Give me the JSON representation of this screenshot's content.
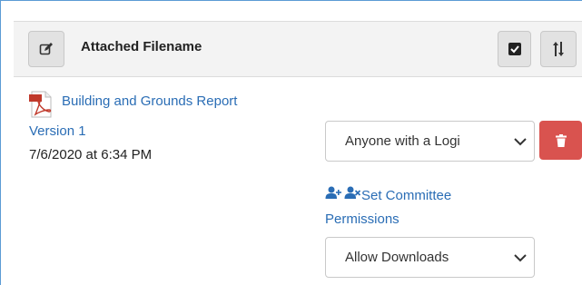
{
  "header": {
    "title": "Attached Filename"
  },
  "attachment": {
    "name": "Building and Grounds Report",
    "version": "Version 1",
    "date": "7/6/2020 at 6:34 PM"
  },
  "access_select": {
    "selected": "Anyone with a Logi"
  },
  "permissions": {
    "link_label": "Set Committee Permissions"
  },
  "download_select": {
    "selected": "Allow Downloads"
  },
  "colors": {
    "link": "#2a6db5",
    "delete": "#d9534f",
    "frame_border": "#5b9bd5"
  }
}
